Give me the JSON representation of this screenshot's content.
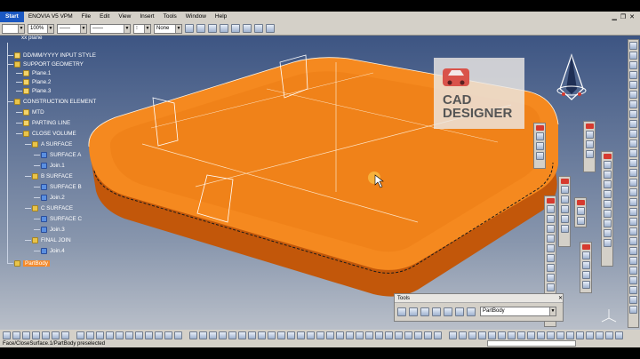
{
  "app": {
    "start_label": "Start",
    "menu": [
      "ENOVIA V5 VPM",
      "File",
      "Edit",
      "View",
      "Insert",
      "Tools",
      "Window",
      "Help"
    ]
  },
  "toolbar": {
    "zoom": "100%",
    "layer": "None"
  },
  "tree": {
    "root": "xx plane",
    "nodes": [
      {
        "label": "DD/MM/YYYY INPUT STYLE"
      },
      {
        "label": "SUPPORT GEOMETRY"
      },
      {
        "label": "Plane.1"
      },
      {
        "label": "Plane.2"
      },
      {
        "label": "Plane.3"
      },
      {
        "label": "CONSTRUCTION ELEMENT"
      },
      {
        "label": "MTD"
      },
      {
        "label": "PARTING LINE"
      },
      {
        "label": "CLOSE VOLUME"
      },
      {
        "label": "A SURFACE"
      },
      {
        "label": "SURFACE A"
      },
      {
        "label": "Join.1"
      },
      {
        "label": "B SURFACE"
      },
      {
        "label": "SURFACE B"
      },
      {
        "label": "Join.2"
      },
      {
        "label": "C SURFACE"
      },
      {
        "label": "SURFACE C"
      },
      {
        "label": "Join.3"
      },
      {
        "label": "FINAL JOIN"
      },
      {
        "label": "Join.4"
      },
      {
        "label": "PartBody"
      }
    ]
  },
  "watermark": {
    "line1": "CAD",
    "line2": "DESIGNER"
  },
  "tools_panel": {
    "title": "Tools",
    "body_value": "PartBody"
  },
  "status": {
    "text": "Face/CloseSurface.1/PartBody preselected"
  },
  "colors": {
    "part": "#f5891f",
    "part_dark": "#c2570a",
    "viewport_top": "#3d5583",
    "viewport_bottom": "#b9bfc9"
  }
}
